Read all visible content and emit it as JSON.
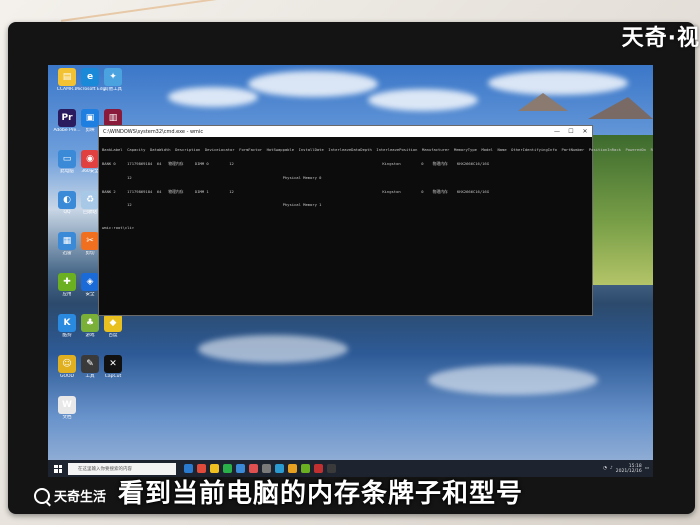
{
  "watermark": {
    "brand_top": "天奇·视",
    "brand_bottom": "天奇生活"
  },
  "subtitle": "看到当前电脑的内存条牌子和型号",
  "desktop_icons": [
    {
      "name": "doc-icon",
      "label": "CCAMR...",
      "color": "#f2c232",
      "glyph": "▤"
    },
    {
      "name": "edge-icon",
      "label": "Microsoft Edge",
      "color": "#1a8ad8",
      "glyph": "e"
    },
    {
      "name": "app-icon",
      "label": "其他工具",
      "color": "#4aa3df",
      "glyph": "✦"
    },
    {
      "name": "premiere-icon",
      "label": "Adobe Pre...",
      "color": "#2a1a5e",
      "glyph": "Pr"
    },
    {
      "name": "app2-icon",
      "label": "剪映",
      "color": "#1e7fe0",
      "glyph": "▣"
    },
    {
      "name": "app3-icon",
      "label": "Adobe...",
      "color": "#8a1a3a",
      "glyph": "▥"
    },
    {
      "name": "computer-icon",
      "label": "此电脑",
      "color": "#3a8ad8",
      "glyph": "▭"
    },
    {
      "name": "app4-icon",
      "label": "360安全",
      "color": "#e04040",
      "glyph": "◉"
    },
    {
      "name": "network-icon",
      "label": "Network",
      "color": "#2a7ad0",
      "glyph": "◍"
    },
    {
      "name": "app5-icon",
      "label": "QQ",
      "color": "#3a8ad8",
      "glyph": "◐"
    },
    {
      "name": "recycle-bin-icon",
      "label": "回收站",
      "color": "#a8c8e8",
      "glyph": "♻"
    },
    {
      "name": "player-icon",
      "label": "腾讯视频",
      "color": "#2ab048",
      "glyph": "▶"
    },
    {
      "name": "app6-icon",
      "label": "迅雷",
      "color": "#3a8ad8",
      "glyph": "▦"
    },
    {
      "name": "app7-icon",
      "label": "剪切",
      "color": "#f07020",
      "glyph": "✂"
    },
    {
      "name": "wechat-icon",
      "label": "微信",
      "color": "#2ab048",
      "glyph": "◎"
    },
    {
      "name": "app8-icon",
      "label": "应用",
      "color": "#6ab020",
      "glyph": "✚"
    },
    {
      "name": "app9-icon",
      "label": "安全",
      "color": "#1a6ad8",
      "glyph": "◈"
    },
    {
      "name": "app10-icon",
      "label": "软件",
      "color": "#e05050",
      "glyph": "✿"
    },
    {
      "name": "app11-icon",
      "label": "酷狗",
      "color": "#2a8ae0",
      "glyph": "K"
    },
    {
      "name": "app12-icon",
      "label": "游戏",
      "color": "#7ab038",
      "glyph": "♣"
    },
    {
      "name": "app13-icon",
      "label": "百度",
      "color": "#e8c020",
      "glyph": "◆"
    },
    {
      "name": "app14-icon",
      "label": "GOOD",
      "color": "#e0b020",
      "glyph": "☺"
    },
    {
      "name": "app15-icon",
      "label": "工具",
      "color": "#3a3a3a",
      "glyph": "✎"
    },
    {
      "name": "capcut-icon",
      "label": "CapCut",
      "color": "#111111",
      "glyph": "✕"
    },
    {
      "name": "file-icon",
      "label": "文档",
      "color": "#e8e8e8",
      "glyph": "W"
    }
  ],
  "cmd": {
    "title": "C:\\WINDOWS\\system32\\cmd.exe - wmic",
    "minimize": "—",
    "maximize": "☐",
    "close": "✕",
    "lines": [
      "BankLabel  Capacity  DataWidth  Description  DeviceLocator  FormFactor  HotSwappable  InstallDate  InterleaveDataDepth  InterleavePosition  Manufacturer  MemoryType  Model  Name  OtherIdentifyingInfo  PartNumber  PositionInRack  PoweredOn  Removable  Replaceable",
      "BANK 0     17179869184  64   物理内存     DIMM 0         12                                                                 Kingston         0    物理内存    KHX2666C16/16G",
      "           12                                                                  Physical Memory 0",
      "BANK 2     17179869184  64   物理内存     DIMM 1         12                                                                 Kingston         0    物理内存    KHX2666C16/16G",
      "           12                                                                  Physical Memory 1",
      "",
      "wmic:root\\cli>"
    ]
  },
  "taskbar": {
    "search_placeholder": "在这里输入你要搜索的内容",
    "clock_time": "15:18",
    "clock_date": "2021/12/16",
    "icons": [
      "#2a7ad0",
      "#e04a3a",
      "#f0c020",
      "#2ab048",
      "#3a8ad8",
      "#e05050",
      "#7a7a7a",
      "#2a9ad0",
      "#e8a020",
      "#6ab020",
      "#c03030",
      "#3a3a3a"
    ]
  }
}
